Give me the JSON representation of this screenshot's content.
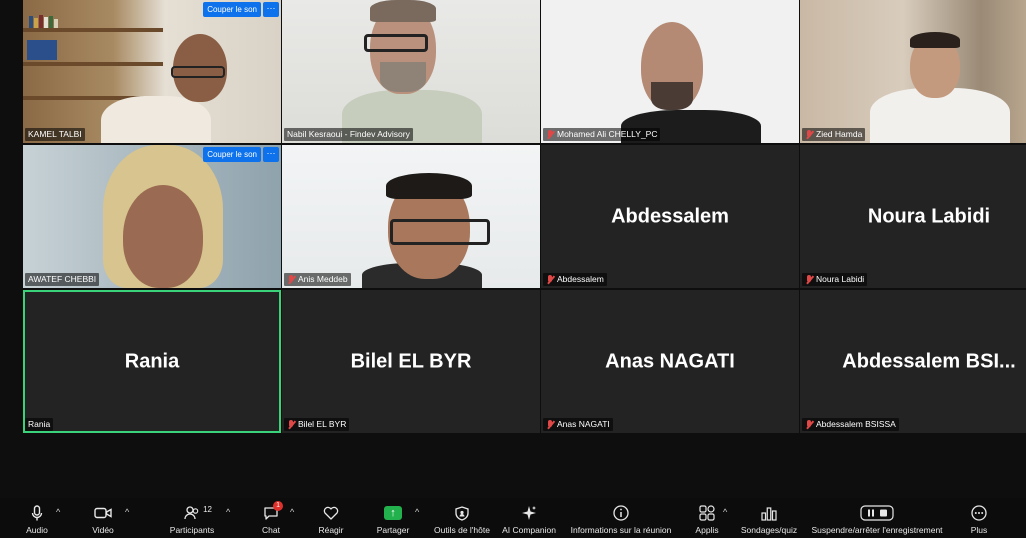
{
  "tile_controls": {
    "mute_label": "Couper le son",
    "more_label": "···"
  },
  "participants": [
    {
      "name_label": "KAMEL TALBI",
      "muted": false
    },
    {
      "name_label": "Nabil Kesraoui - Findev Advisory",
      "muted": false
    },
    {
      "name_label": "Mohamed Ali CHELLY_PC",
      "muted": true
    },
    {
      "name_label": "Zied Hamda",
      "muted": true
    },
    {
      "name_label": "AWATEF CHEBBI",
      "muted": false
    },
    {
      "name_label": "Anis Meddeb",
      "muted": true
    },
    {
      "big_name": "Abdessalem",
      "name_label": "Abdessalem",
      "muted": true
    },
    {
      "big_name": "Noura Labidi",
      "name_label": "Noura Labidi",
      "muted": true
    },
    {
      "big_name": "Rania",
      "name_label": "Rania",
      "muted": false
    },
    {
      "big_name": "Bilel EL BYR",
      "name_label": "Bilel EL BYR",
      "muted": true
    },
    {
      "big_name": "Anas NAGATI",
      "name_label": "Anas NAGATI",
      "muted": true
    },
    {
      "big_name": "Abdessalem  BSI...",
      "name_label": "Abdessalem BSISSA",
      "muted": true
    }
  ],
  "toolbar": {
    "audio": "Audio",
    "video": "Vidéo",
    "participants": "Participants",
    "participants_count": "12",
    "chat": "Chat",
    "chat_badge": "1",
    "react": "Réagir",
    "share": "Partager",
    "host_tools": "Outils de l'hôte",
    "ai_companion": "AI Companion",
    "meeting_info": "Informations sur la réunion",
    "apps": "Applis",
    "polls": "Sondages/quiz",
    "recording": "Suspendre/arrêter l'enregistrement",
    "more": "Plus"
  },
  "colors": {
    "active_speaker": "#3bd37a",
    "accent": "#0e72ed",
    "share": "#22b14c",
    "muted": "#e04848"
  }
}
